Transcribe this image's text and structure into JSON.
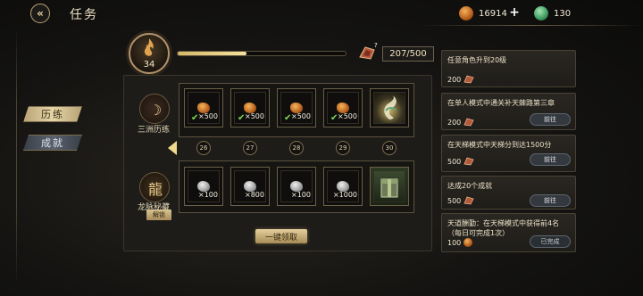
{
  "header": {
    "back_icon": "back-arrow-icon",
    "title": "任务",
    "currencies": [
      {
        "icon": "ore-icon",
        "value": "16914"
      },
      {
        "icon": "jade-icon",
        "value": "130"
      }
    ],
    "add_icon": "plus-icon"
  },
  "nav": {
    "items": [
      {
        "label": "历练",
        "active": true
      },
      {
        "label": "成就",
        "active": false
      }
    ]
  },
  "progress": {
    "level": "34",
    "xp_text": "207/500",
    "xp_fraction": 0.41,
    "help": "?"
  },
  "tracks": {
    "free": {
      "name": "三洲历练",
      "rewards": [
        {
          "type": "ore",
          "qty": "×500",
          "claimed": true
        },
        {
          "type": "ore",
          "qty": "×500",
          "claimed": true
        },
        {
          "type": "ore",
          "qty": "×500",
          "claimed": true
        },
        {
          "type": "ore",
          "qty": "×500",
          "claimed": true
        },
        {
          "type": "special",
          "qty": "",
          "claimed": false
        }
      ]
    },
    "levels": [
      "26",
      "27",
      "28",
      "29",
      "30"
    ],
    "premium": {
      "name": "龙脉秘藏",
      "unlock_label": "解锁",
      "rewards": [
        {
          "type": "stone",
          "qty": "×100"
        },
        {
          "type": "stone",
          "qty": "×800"
        },
        {
          "type": "stone",
          "qty": "×100"
        },
        {
          "type": "stone",
          "qty": "×1000"
        },
        {
          "type": "gift",
          "qty": ""
        }
      ]
    },
    "claim_all": "一键领取"
  },
  "tasks": [
    {
      "title": "任意角色升到20级",
      "reward": "200",
      "button": ""
    },
    {
      "title": "在单人模式中通关补天棘路第三章",
      "reward": "200",
      "button": "前往"
    },
    {
      "title": "在天梯模式中天梯分到达1500分",
      "reward": "500",
      "button": "前往"
    },
    {
      "title": "达成20个成就",
      "reward": "500",
      "button": "前往"
    },
    {
      "title": "天道酬勤：在天梯模式中获得前4名（每日可完成1次）",
      "reward": "100",
      "button": "已完成",
      "reward_icon": "ore-icon"
    }
  ],
  "colors": {
    "accent_gold": "#e5d09d",
    "check_green": "#7ed957",
    "ore_orange": "#d9873a"
  }
}
